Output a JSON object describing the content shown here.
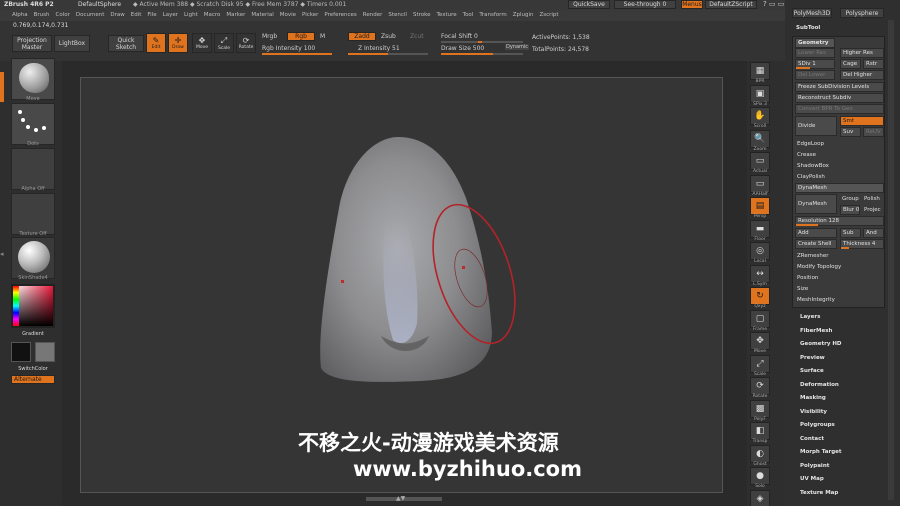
{
  "titlebar": {
    "left_text": "ZBrush 4R6 P2",
    "project": "DefaultSphere",
    "stats": "◆ Active Mem 388 ◆ Scratch Disk 95 ◆ Free Mem 3787 ◆ Timers 0.001",
    "quicksave": "QuickSave",
    "see_through": "See-through  0",
    "menus": "Menus",
    "default_script": "DefaultZScript"
  },
  "menubar": [
    "Alpha",
    "Brush",
    "Color",
    "Document",
    "Draw",
    "Edit",
    "File",
    "Layer",
    "Light",
    "Macro",
    "Marker",
    "Material",
    "Movie",
    "Picker",
    "Preferences",
    "Render",
    "Stencil",
    "Stroke",
    "Texture",
    "Tool",
    "Transform",
    "Zplugin",
    "Zscript"
  ],
  "shelf": {
    "coords": "0.769,0.174,0.731",
    "projection_master": "Projection\nMaster",
    "lightbox": "LightBox",
    "quick_sketch": "Quick\nSketch",
    "edit": "Edit",
    "draw": "Draw",
    "move": "Move",
    "scale": "Scale",
    "rotate": "Rotate",
    "mrgb": "Mrgb",
    "rgb": "Rgb",
    "m": "M",
    "zadd": "Zadd",
    "zsub": "Zsub",
    "zcut": "Zcut",
    "rgb_intensity": "Rgb Intensity 100",
    "z_intensity": "Z Intensity 51",
    "focal_shift": "Focal Shift 0",
    "draw_size": "Draw Size 500",
    "dynamic": "Dynamic",
    "active_points": "ActivePoints: 1,538",
    "total_points": "TotalPoints: 24,578"
  },
  "leftshelf": {
    "brush_label": "Move",
    "stroke_label": "Dots",
    "alpha_label": "Alpha Off",
    "texture_label": "Texture Off",
    "material_label": "SkinShade4",
    "gradient": "Gradient",
    "switch_color": "SwitchColor",
    "alternate": "Alternate"
  },
  "rightshelf": [
    "BPR",
    "SPix 3",
    "Scroll",
    "Zoom",
    "Actual",
    "AAHalf",
    "Persp",
    "Floor",
    "Local",
    "L.Sym",
    "Qxyz",
    "Frame",
    "Move",
    "Scale",
    "Rotate",
    "PolyF",
    "Transp",
    "Ghost",
    "Solo",
    "Xpose"
  ],
  "tray": {
    "top_tabs": [
      "PolyMesh3D",
      "Polysphere"
    ],
    "subtool": "SubTool",
    "geometry": "Geometry",
    "lower_res": "Lower Res",
    "higher_res": "Higher Res",
    "sdiv": "SDiv 1",
    "cage": "Cage",
    "rstr": "Rstr",
    "del_lower": "Del Lower",
    "del_higher": "Del Higher",
    "freeze": "Freeze SubDivision Levels",
    "reconstruct": "Reconstruct Subdiv",
    "convert_bpr": "Convert BPR To Geo",
    "divide": "Divide",
    "smt": "Smt",
    "suv": "Suv",
    "reuv": "ReUV",
    "edgeloop": "EdgeLoop",
    "crease": "Crease",
    "shadowbox": "ShadowBox",
    "claypolish": "ClayPolish",
    "dynamesh_hdr": "DynaMesh",
    "dynamesh": "DynaMesh",
    "group": "Group",
    "polish": "Polish",
    "blur": "Blur",
    "blur_val": "0",
    "projec": "Projec",
    "resolution": "Resolution 128",
    "add": "Add",
    "sub": "Sub",
    "and": "And",
    "create_shell": "Create Shell",
    "thickness": "Thickness 4",
    "zremesher": "ZRemesher",
    "modify_topology": "Modify Topology",
    "position": "Position",
    "size": "Size",
    "meshintegrity": "MeshIntegrity",
    "sections": [
      "Layers",
      "FiberMesh",
      "Geometry HD",
      "Preview",
      "Surface",
      "Deformation",
      "Masking",
      "Visibility",
      "Polygroups",
      "Contact",
      "Morph Target",
      "Polypaint",
      "UV Map",
      "Texture Map"
    ]
  },
  "watermark": {
    "line1": "不移之火-动漫游戏美术资源",
    "line2": "www.byzhihuo.com"
  },
  "colors": {
    "accent": "#e0731d",
    "background": "#2b2b2b",
    "panel": "#3a3a3a",
    "ring": "#b3232a",
    "mesh": "#8f8f8f"
  }
}
